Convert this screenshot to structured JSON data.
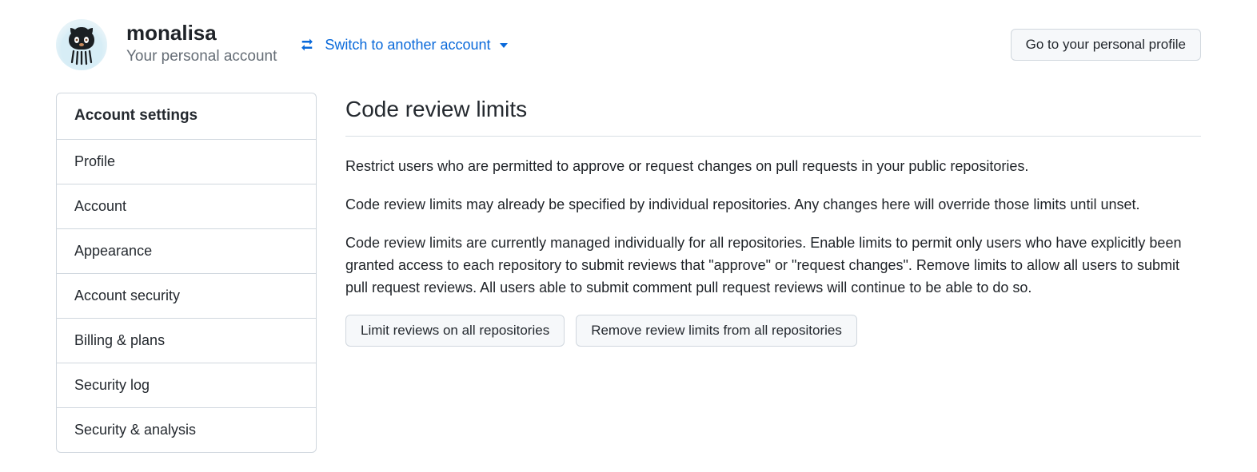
{
  "header": {
    "username": "monalisa",
    "account_type": "Your personal account",
    "switch_label": "Switch to another account",
    "profile_button": "Go to your personal profile"
  },
  "sidebar": {
    "title": "Account settings",
    "items": [
      {
        "label": "Profile"
      },
      {
        "label": "Account"
      },
      {
        "label": "Appearance"
      },
      {
        "label": "Account security"
      },
      {
        "label": "Billing & plans"
      },
      {
        "label": "Security log"
      },
      {
        "label": "Security & analysis"
      }
    ]
  },
  "main": {
    "title": "Code review limits",
    "p1": "Restrict users who are permitted to approve or request changes on pull requests in your public repositories.",
    "p2": "Code review limits may already be specified by individual repositories. Any changes here will override those limits until unset.",
    "p3": "Code review limits are currently managed individually for all repositories. Enable limits to permit only users who have explicitly been granted access to each repository to submit reviews that \"approve\" or \"request changes\". Remove limits to allow all users to submit pull request reviews. All users able to submit comment pull request reviews will continue to be able to do so.",
    "limit_button": "Limit reviews on all repositories",
    "remove_button": "Remove review limits from all repositories"
  }
}
